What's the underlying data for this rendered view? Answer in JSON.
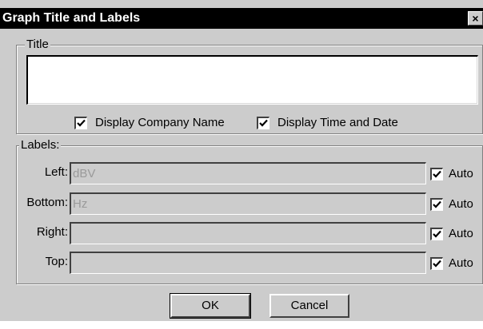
{
  "window": {
    "title": "Graph Title and Labels",
    "close_glyph": "×"
  },
  "title_group": {
    "legend": "Title",
    "value": "",
    "display_company_name": {
      "label": "Display Company Name",
      "checked": true
    },
    "display_time_and_date": {
      "label": "Display Time and Date",
      "checked": true
    }
  },
  "labels_group": {
    "legend": "Labels:",
    "rows": [
      {
        "label": "Left:",
        "value": "dBV",
        "auto_label": "Auto",
        "auto_checked": true
      },
      {
        "label": "Bottom:",
        "value": "Hz",
        "auto_label": "Auto",
        "auto_checked": true
      },
      {
        "label": "Right:",
        "value": "",
        "auto_label": "Auto",
        "auto_checked": true
      },
      {
        "label": "Top:",
        "value": "",
        "auto_label": "Auto",
        "auto_checked": true
      }
    ]
  },
  "buttons": {
    "ok": "OK",
    "cancel": "Cancel"
  },
  "icons": {
    "checkmark": "check-icon",
    "close": "close-icon"
  },
  "colors": {
    "dialog_face": "#cccccc",
    "titlebar": "#000000",
    "titlebar_text": "#ffffff",
    "disabled_text": "#9a9a9a"
  }
}
